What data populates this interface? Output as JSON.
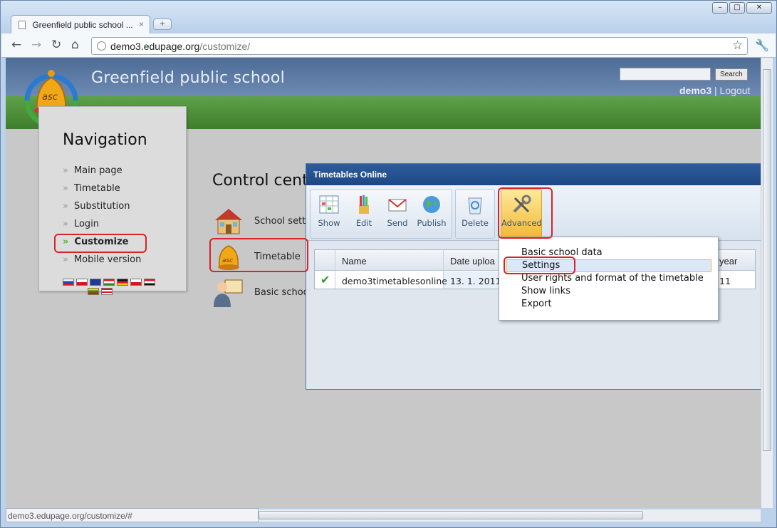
{
  "browser": {
    "tab_title": "Greenfield public school ...",
    "tab_close": "×",
    "new_tab": "+",
    "url_host": "demo3.edupage.org",
    "url_path": "/customize/",
    "status_url": "demo3.edupage.org/customize/#",
    "controls": {
      "minimize": "–",
      "maximize": "□",
      "close": "✕"
    },
    "icons": {
      "back": "back-arrow-icon",
      "forward": "forward-arrow-icon",
      "reload": "reload-icon",
      "home": "home-icon",
      "star": "bookmark-star-icon",
      "wrench": "wrench-icon"
    }
  },
  "site": {
    "title": "Greenfield public school",
    "search_button": "Search",
    "username": "demo3",
    "separator": "|",
    "logout": "Logout",
    "colors": {
      "header": "#4d6c96",
      "green_bar": "#4f9138",
      "highlight": "#d8232a"
    }
  },
  "navigation": {
    "heading": "Navigation",
    "items": [
      {
        "label": "Main page"
      },
      {
        "label": "Timetable"
      },
      {
        "label": "Substitution"
      },
      {
        "label": "Login"
      },
      {
        "label": "Customize"
      },
      {
        "label": "Mobile version"
      }
    ],
    "arrow": "»"
  },
  "control_center": {
    "title": "Control cent",
    "items": [
      {
        "label": "School setti",
        "icon": "house-icon"
      },
      {
        "label": "Timetable",
        "icon": "bell-icon"
      },
      {
        "label": "Basic schoo",
        "icon": "teacher-icon"
      }
    ]
  },
  "dialog": {
    "title": "Timetables Online",
    "ribbon": [
      {
        "label": "Show",
        "icon": "grid-show-icon"
      },
      {
        "label": "Edit",
        "icon": "pencils-edit-icon"
      },
      {
        "label": "Send",
        "icon": "envelope-send-icon"
      },
      {
        "label": "Publish",
        "icon": "globe-publish-icon"
      },
      {
        "label": "Delete",
        "icon": "recycle-bin-icon"
      },
      {
        "label": "Advanced",
        "icon": "tools-icon"
      }
    ],
    "table": {
      "headers": [
        "Name",
        "Date uploa",
        "year"
      ],
      "row": {
        "name": "demo3timetablesonline",
        "date": "13. 1. 2011 1",
        "year": "11"
      }
    }
  },
  "advanced_menu": {
    "items": [
      {
        "label": "Basic school data"
      },
      {
        "label": "Settings"
      },
      {
        "label": "User rights and format of the timetable"
      },
      {
        "label": "Show links"
      },
      {
        "label": "Export"
      }
    ],
    "selected": "Settings"
  }
}
